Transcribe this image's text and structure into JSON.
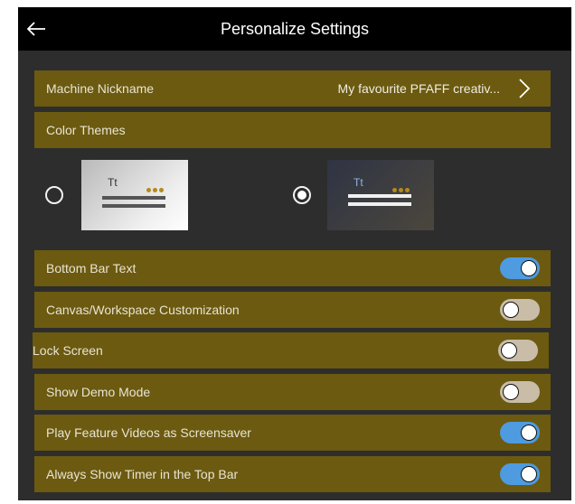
{
  "header": {
    "title": "Personalize Settings",
    "back_icon": "arrow-left-icon"
  },
  "machine_nickname": {
    "label": "Machine Nickname",
    "value": "My favourite PFAFF creativ...",
    "chevron_icon": "chevron-right-icon"
  },
  "color_themes": {
    "label": "Color Themes",
    "options": [
      {
        "name": "light",
        "sample_text": "Tt",
        "selected": false
      },
      {
        "name": "dark",
        "sample_text": "Tt",
        "selected": true
      }
    ]
  },
  "toggles": [
    {
      "label": "Bottom Bar Text",
      "on": true
    },
    {
      "label": "Canvas/Workspace Customization",
      "on": false
    },
    {
      "label": "Lock Screen",
      "on": false
    },
    {
      "label": "Show Demo Mode",
      "on": false
    },
    {
      "label": "Play Feature Videos as Screensaver",
      "on": true
    },
    {
      "label": "Always Show Timer in the Top Bar",
      "on": true
    }
  ],
  "colors": {
    "row_background": "#6b5a10",
    "toggle_on": "#4e9be0",
    "toggle_off": "#c9bda8",
    "screen_background": "#2d2d2d"
  }
}
